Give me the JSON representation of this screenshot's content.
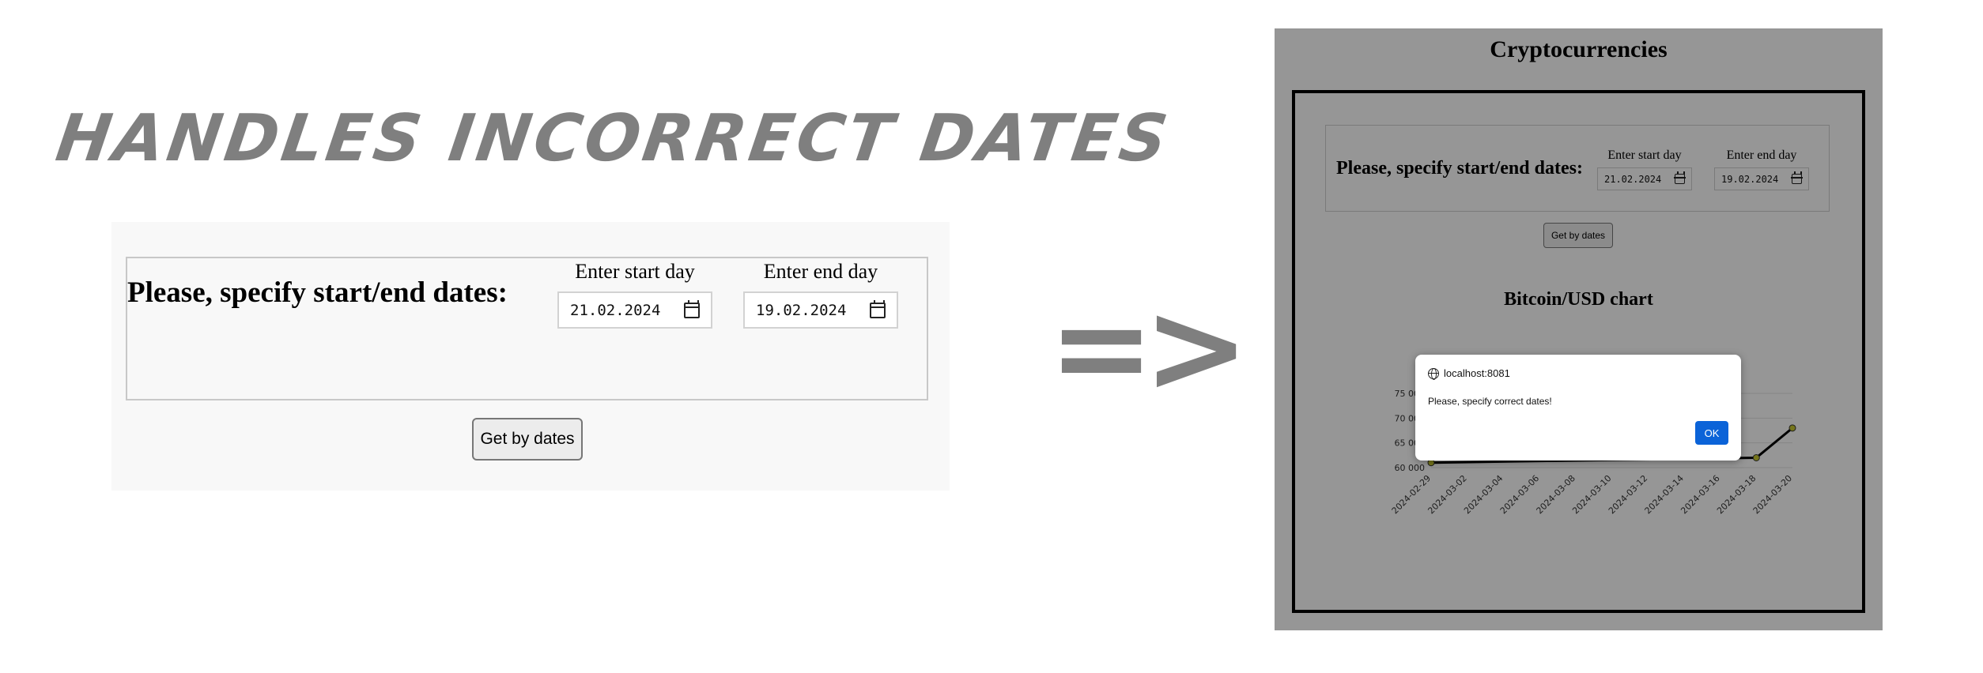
{
  "headline": "HANDLES INCORRECT DATES",
  "arrow": "=>",
  "form": {
    "legend": "Please, specify start/end dates:",
    "start_label": "Enter start day",
    "start_value": "21.02.2024",
    "end_label": "Enter end day",
    "end_value": "19.02.2024",
    "submit_label": "Get by dates"
  },
  "screenshot": {
    "title": "Cryptocurrencies",
    "chart_title": "Bitcoin/USD chart",
    "dialog": {
      "origin": "localhost:8081",
      "message": "Please, specify correct dates!",
      "ok_label": "OK"
    }
  },
  "chart_data": {
    "type": "line",
    "title": "Bitcoin/USD chart",
    "x": [
      "2024-02-29",
      "2024-03-02",
      "2024-03-04",
      "2024-03-06",
      "2024-03-08",
      "2024-03-10",
      "2024-03-12",
      "2024-03-14",
      "2024-03-16",
      "2024-03-18",
      "2024-03-20"
    ],
    "y_ticks": [
      60000,
      65000,
      70000,
      75000
    ],
    "y_tick_labels": [
      "60 000",
      "65 000",
      "70 000",
      "75 000"
    ],
    "ylim": [
      60000,
      75000
    ],
    "visible_points": [
      {
        "x": "2024-02-29",
        "y": 61000
      },
      {
        "x": "2024-03-18",
        "y": 62000
      },
      {
        "x": "2024-03-20",
        "y": 68000
      }
    ],
    "line_color": "#000000",
    "marker_color": "#c8c830"
  }
}
